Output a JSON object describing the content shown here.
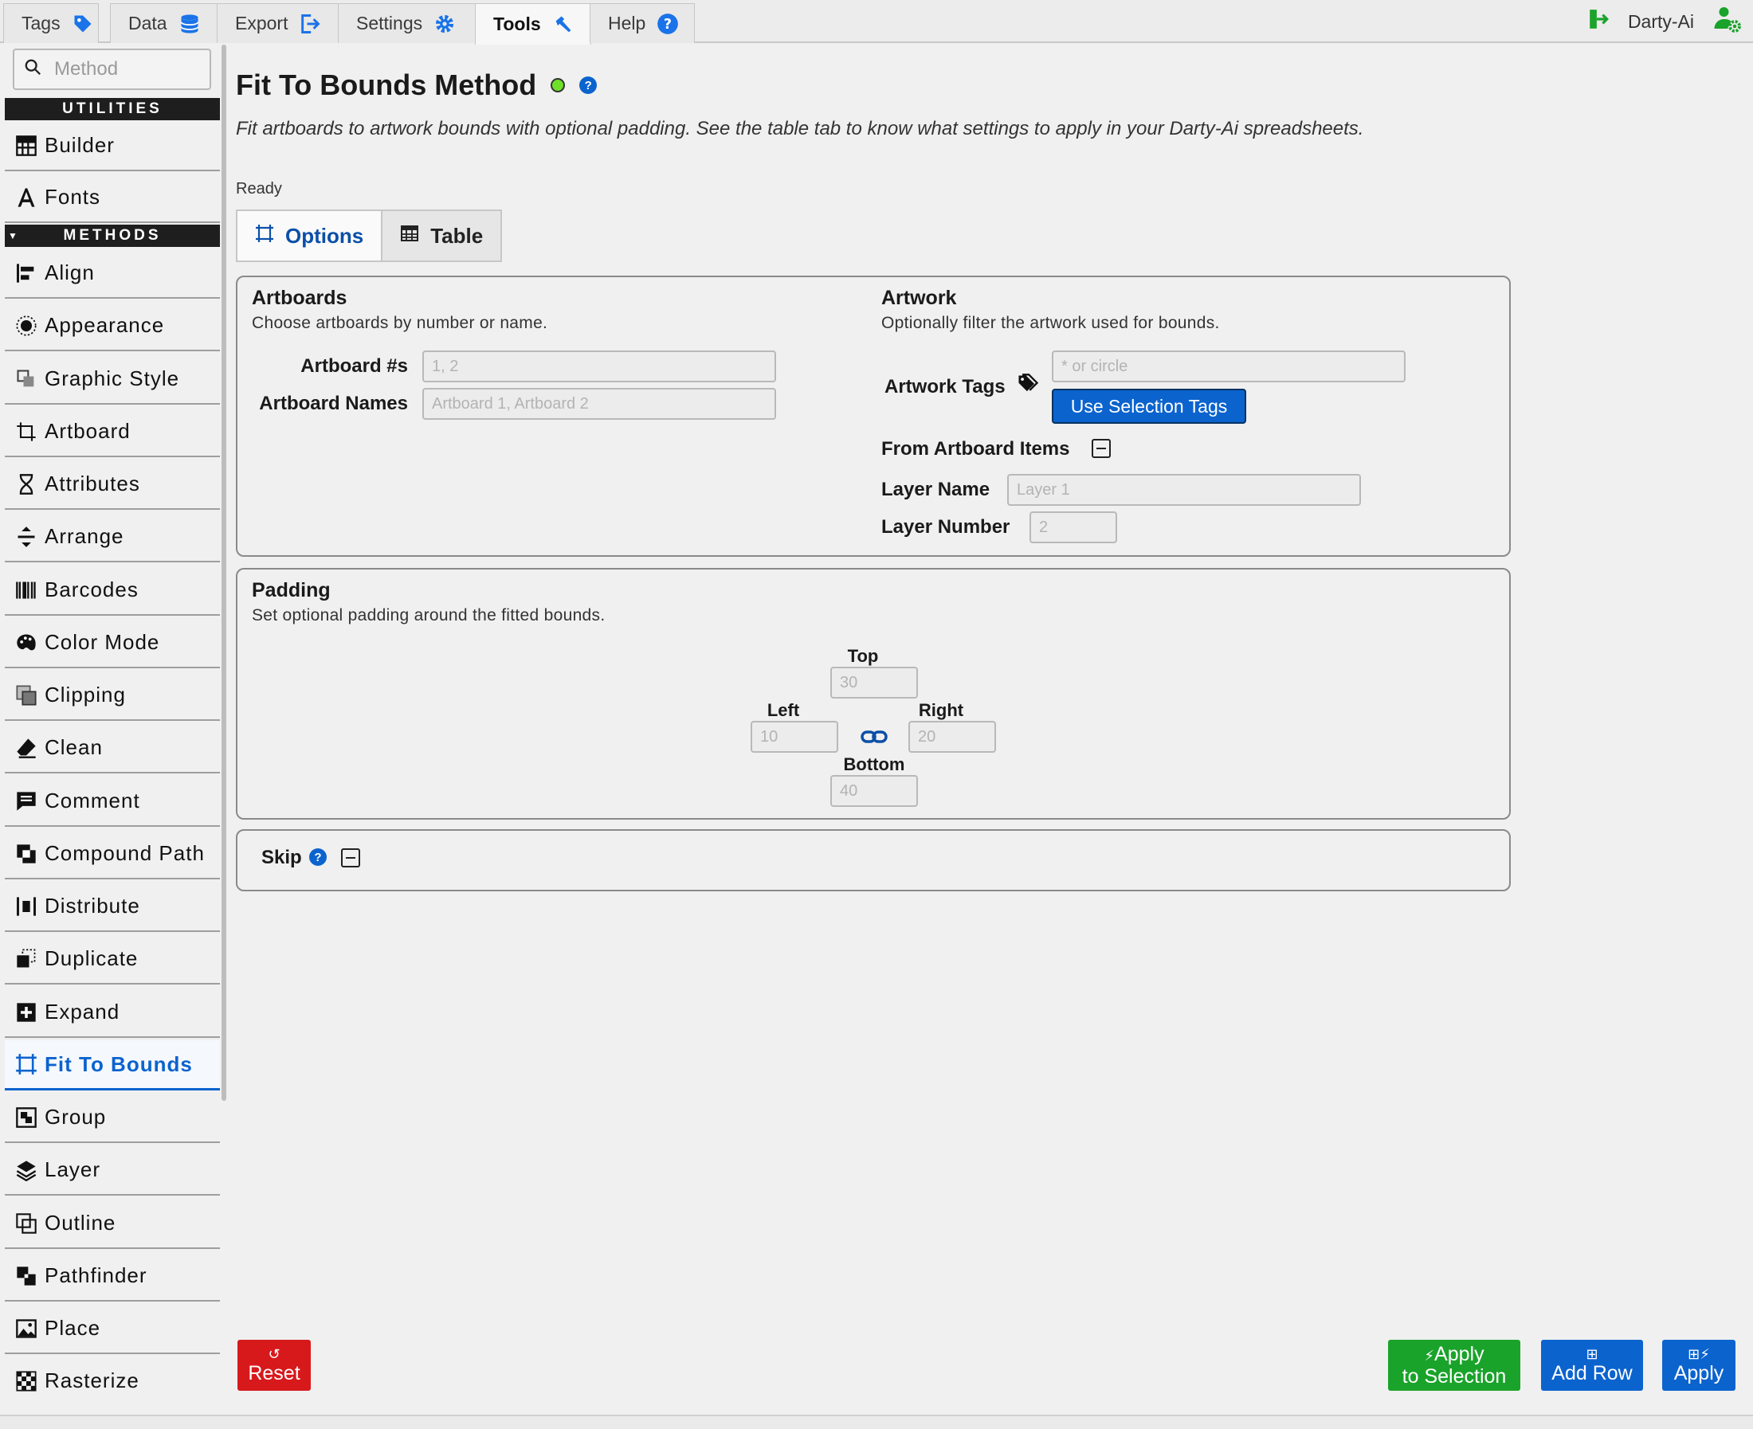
{
  "top_tabs": [
    {
      "label": "Tags",
      "icon": "tag-icon"
    },
    {
      "label": "Data",
      "icon": "database-icon"
    },
    {
      "label": "Export",
      "icon": "export-icon"
    },
    {
      "label": "Settings",
      "icon": "gear-icon"
    },
    {
      "label": "Tools",
      "icon": "hammer-icon",
      "active": true
    },
    {
      "label": "Help",
      "icon": "help-icon"
    }
  ],
  "user": {
    "name": "Darty-Ai"
  },
  "sidebar": {
    "search_placeholder": "Method",
    "utilities_header": "UTILITIES",
    "methods_header": "METHODS",
    "utilities": [
      {
        "label": "Builder",
        "icon": "builder-icon"
      },
      {
        "label": "Fonts",
        "icon": "font-icon"
      }
    ],
    "methods": [
      {
        "label": "Align",
        "icon": "align-icon"
      },
      {
        "label": "Appearance",
        "icon": "appearance-icon"
      },
      {
        "label": "Graphic Style",
        "icon": "graphic-style-icon"
      },
      {
        "label": "Artboard",
        "icon": "artboard-icon"
      },
      {
        "label": "Attributes",
        "icon": "attributes-icon"
      },
      {
        "label": "Arrange",
        "icon": "arrange-icon"
      },
      {
        "label": "Barcodes",
        "icon": "barcode-icon"
      },
      {
        "label": "Color Mode",
        "icon": "palette-icon"
      },
      {
        "label": "Clipping",
        "icon": "clipping-icon"
      },
      {
        "label": "Clean",
        "icon": "eraser-icon"
      },
      {
        "label": "Comment",
        "icon": "comment-icon"
      },
      {
        "label": "Compound Path",
        "icon": "compound-path-icon"
      },
      {
        "label": "Distribute",
        "icon": "distribute-icon"
      },
      {
        "label": "Duplicate",
        "icon": "duplicate-icon"
      },
      {
        "label": "Expand",
        "icon": "expand-icon"
      },
      {
        "label": "Fit To Bounds",
        "icon": "fit-bounds-icon",
        "active": true
      },
      {
        "label": "Group",
        "icon": "group-icon"
      },
      {
        "label": "Layer",
        "icon": "layer-icon"
      },
      {
        "label": "Outline",
        "icon": "outline-icon"
      },
      {
        "label": "Pathfinder",
        "icon": "pathfinder-icon"
      },
      {
        "label": "Place",
        "icon": "image-icon"
      },
      {
        "label": "Rasterize",
        "icon": "checker-icon"
      }
    ]
  },
  "main": {
    "title": "Fit To Bounds Method",
    "description": "Fit artboards to artwork bounds with optional padding. See the table tab to know what settings to apply in your Darty-Ai spreadsheets.",
    "status": "Ready",
    "tabs": [
      {
        "label": "Options",
        "icon": "fit-bounds-icon",
        "active": true
      },
      {
        "label": "Table",
        "icon": "table-icon"
      }
    ],
    "artboards": {
      "title": "Artboards",
      "subtitle": "Choose artboards by number or name.",
      "numbers_label": "Artboard #s",
      "numbers_placeholder": "1, 2",
      "names_label": "Artboard Names",
      "names_placeholder": "Artboard 1, Artboard 2"
    },
    "artwork": {
      "title": "Artwork",
      "subtitle": "Optionally filter the artwork used for bounds.",
      "tags_label": "Artwork Tags",
      "tags_placeholder": "* or circle",
      "use_selection_tags": "Use Selection Tags",
      "from_items_label": "From Artboard Items",
      "layer_name_label": "Layer Name",
      "layer_name_placeholder": "Layer 1",
      "layer_number_label": "Layer Number",
      "layer_number_placeholder": "2"
    },
    "padding": {
      "title": "Padding",
      "subtitle": "Set optional padding around the fitted bounds.",
      "top_label": "Top",
      "top_placeholder": "30",
      "left_label": "Left",
      "left_placeholder": "10",
      "right_label": "Right",
      "right_placeholder": "20",
      "bottom_label": "Bottom",
      "bottom_placeholder": "40"
    },
    "skip": {
      "label": "Skip"
    }
  },
  "footer": {
    "reset": "Reset",
    "apply_selection_line1": "Apply",
    "apply_selection_line2": "to Selection",
    "add_row": "Add Row",
    "apply": "Apply"
  },
  "colors": {
    "accent": "#0b63ce",
    "danger": "#d7191c",
    "success": "#1aa32a",
    "status_ok": "#6fe02a"
  }
}
